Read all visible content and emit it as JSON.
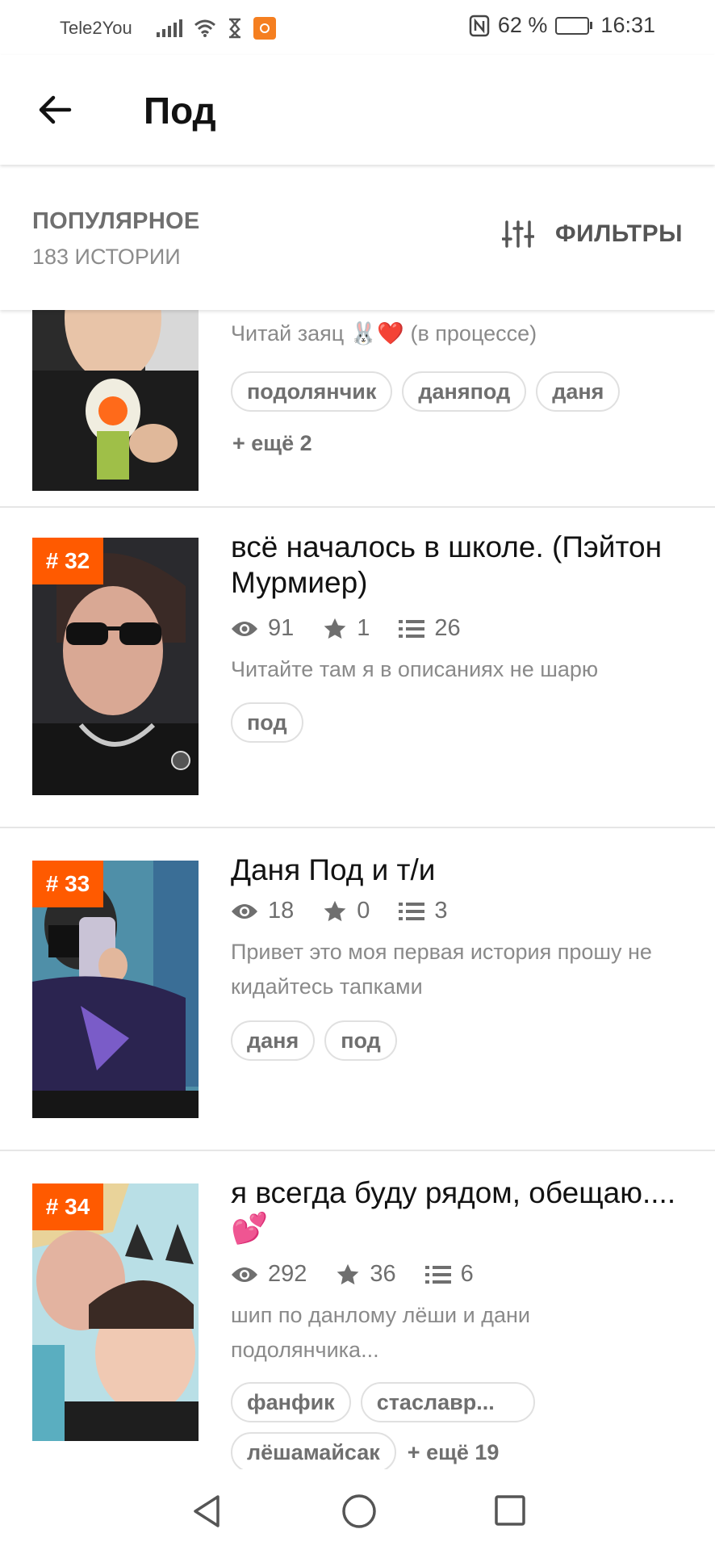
{
  "status": {
    "carrier": "Tele2You",
    "battery": "62 %",
    "battery_level": 0.62,
    "time": "16:31"
  },
  "appbar": {
    "title": "Под"
  },
  "sort": {
    "label": "ПОПУЛЯРНОЕ",
    "count": "183 ИСТОРИИ",
    "filters_label": "ФИЛЬТРЫ"
  },
  "stories": [
    {
      "description": "Читай заяц 🐰❤️ (в процессе)",
      "tags": [
        "подолянчик",
        "даняпод",
        "даня"
      ],
      "more": "+ ещё 2"
    },
    {
      "rank": "# 32",
      "title": "всё началось в школе. (Пэйтон Мурмиер)",
      "views": "91",
      "votes": "1",
      "parts": "26",
      "description": "Читайте там я в описаниях не шарю",
      "tags": [
        "под"
      ]
    },
    {
      "rank": "# 33",
      "title": "Даня Под и т/и",
      "views": "18",
      "votes": "0",
      "parts": "3",
      "description": "Привет это моя первая история прошу не кидайтесь тапками",
      "tags": [
        "даня",
        "под"
      ]
    },
    {
      "rank": "# 34",
      "title": "я всегда буду рядом, обещаю.... 💕",
      "views": "292",
      "votes": "36",
      "parts": "6",
      "description": "шип по данлому лёши и дани подолянчика...",
      "tags": [
        "фанфик",
        "стаславр...",
        "лёшамайсак"
      ],
      "more": "+ ещё 19"
    }
  ]
}
